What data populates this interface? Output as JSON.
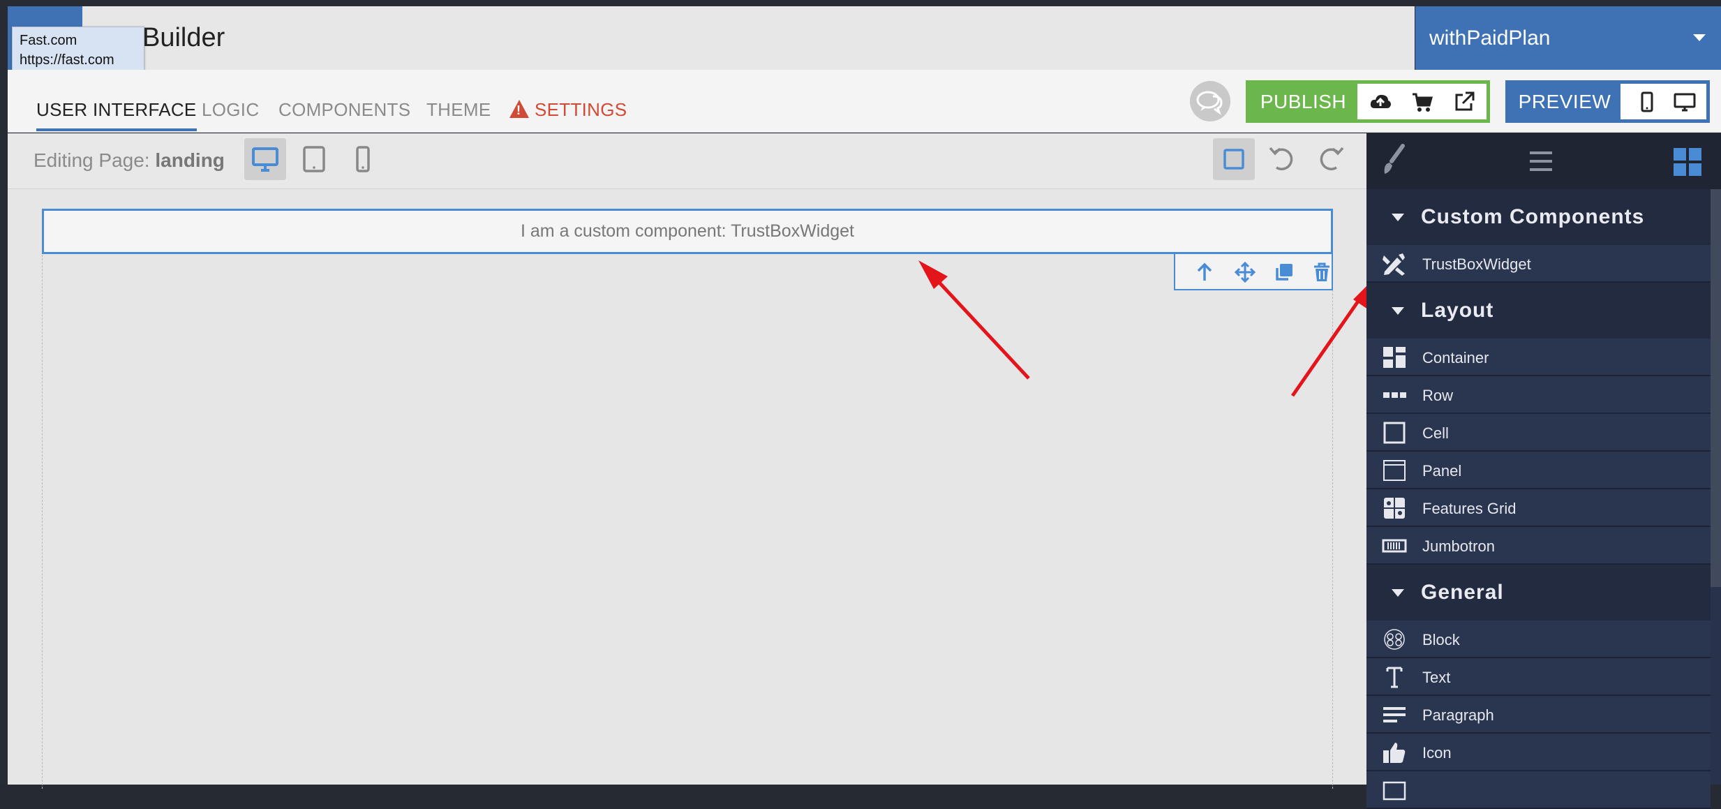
{
  "header": {
    "app_title": "Builder",
    "plan_selector": "withPaidPlan",
    "tooltip": {
      "line1": "Fast.com",
      "line2": "https://fast.com"
    }
  },
  "nav": {
    "tabs": [
      {
        "label": "USER INTERFACE"
      },
      {
        "label": "LOGIC"
      },
      {
        "label": "COMPONENTS"
      },
      {
        "label": "THEME"
      },
      {
        "label": "SETTINGS"
      }
    ],
    "publish_label": "PUBLISH",
    "preview_label": "PREVIEW"
  },
  "editor": {
    "editing_prefix": "Editing Page:",
    "page_name": "landing"
  },
  "canvas": {
    "widget_text": "I am a custom component: TrustBoxWidget"
  },
  "sidebar": {
    "groups": [
      {
        "title": "Custom Components",
        "items": [
          {
            "label": "TrustBoxWidget",
            "icon": "pencil-ruler-icon"
          }
        ]
      },
      {
        "title": "Layout",
        "items": [
          {
            "label": "Container",
            "icon": "container-icon"
          },
          {
            "label": "Row",
            "icon": "row-icon"
          },
          {
            "label": "Cell",
            "icon": "cell-icon"
          },
          {
            "label": "Panel",
            "icon": "panel-icon"
          },
          {
            "label": "Features Grid",
            "icon": "features-grid-icon"
          },
          {
            "label": "Jumbotron",
            "icon": "jumbotron-icon"
          }
        ]
      },
      {
        "title": "General",
        "items": [
          {
            "label": "Block",
            "icon": "block-icon"
          },
          {
            "label": "Text",
            "icon": "text-icon"
          },
          {
            "label": "Paragraph",
            "icon": "paragraph-icon"
          },
          {
            "label": "Icon",
            "icon": "thumbs-up-icon"
          }
        ]
      }
    ]
  },
  "colors": {
    "brand_blue": "#3e72b5",
    "publish_green": "#6cb74c",
    "warning_red": "#d04a36",
    "selection_blue": "#4a8bd6",
    "sidebar_bg": "#28324a",
    "annotation_arrow": "#e3151a"
  }
}
